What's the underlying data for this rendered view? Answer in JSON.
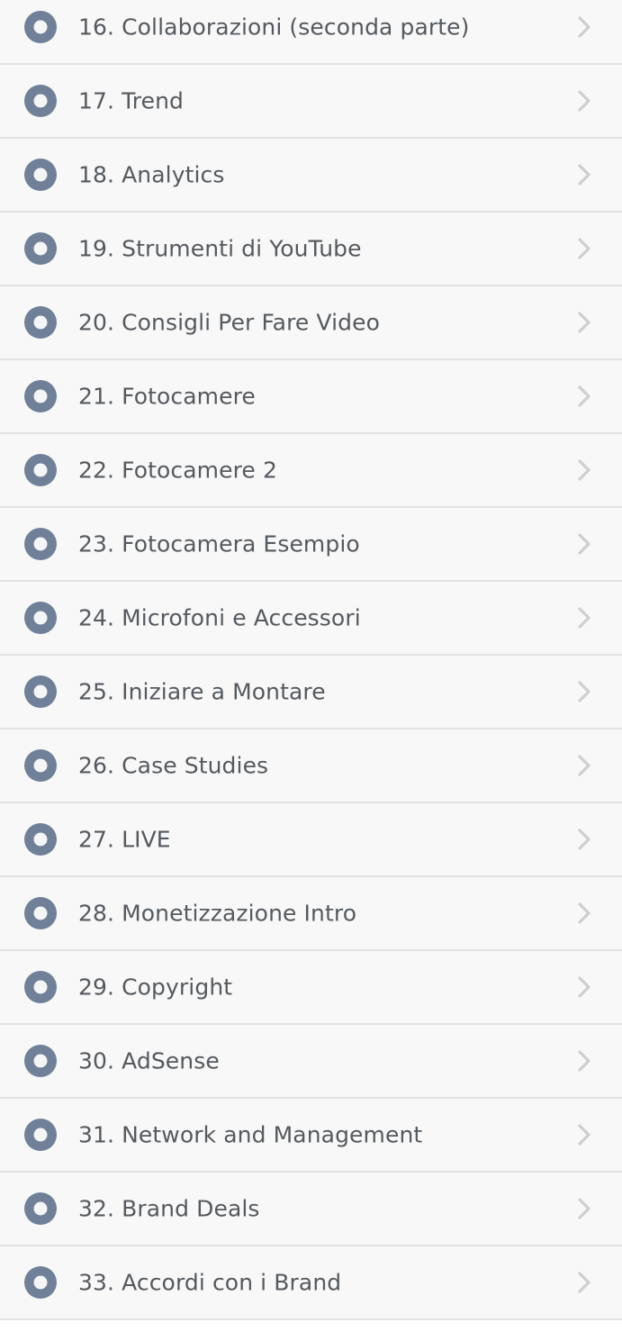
{
  "colors": {
    "row_background": "#f8f8f8",
    "divider": "#e3e3e3",
    "text": "#555a5f",
    "icon_outer": "#6f8098",
    "icon_inner": "#f4f5f7",
    "chevron": "#cfcfcf"
  },
  "lessons": [
    {
      "label": "16. Collaborazioni (seconda parte)",
      "icon": "lesson-status-icon",
      "chevron": "chevron-right-icon"
    },
    {
      "label": "17. Trend",
      "icon": "lesson-status-icon",
      "chevron": "chevron-right-icon"
    },
    {
      "label": "18. Analytics",
      "icon": "lesson-status-icon",
      "chevron": "chevron-right-icon"
    },
    {
      "label": "19. Strumenti di YouTube",
      "icon": "lesson-status-icon",
      "chevron": "chevron-right-icon"
    },
    {
      "label": "20. Consigli Per Fare Video",
      "icon": "lesson-status-icon",
      "chevron": "chevron-right-icon"
    },
    {
      "label": "21. Fotocamere",
      "icon": "lesson-status-icon",
      "chevron": "chevron-right-icon"
    },
    {
      "label": "22. Fotocamere 2",
      "icon": "lesson-status-icon",
      "chevron": "chevron-right-icon"
    },
    {
      "label": "23. Fotocamera Esempio",
      "icon": "lesson-status-icon",
      "chevron": "chevron-right-icon"
    },
    {
      "label": "24. Microfoni e Accessori",
      "icon": "lesson-status-icon",
      "chevron": "chevron-right-icon"
    },
    {
      "label": "25. Iniziare a Montare",
      "icon": "lesson-status-icon",
      "chevron": "chevron-right-icon"
    },
    {
      "label": "26. Case Studies",
      "icon": "lesson-status-icon",
      "chevron": "chevron-right-icon"
    },
    {
      "label": "27. LIVE",
      "icon": "lesson-status-icon",
      "chevron": "chevron-right-icon"
    },
    {
      "label": "28. Monetizzazione Intro",
      "icon": "lesson-status-icon",
      "chevron": "chevron-right-icon"
    },
    {
      "label": "29. Copyright",
      "icon": "lesson-status-icon",
      "chevron": "chevron-right-icon"
    },
    {
      "label": "30. AdSense",
      "icon": "lesson-status-icon",
      "chevron": "chevron-right-icon"
    },
    {
      "label": "31. Network and Management",
      "icon": "lesson-status-icon",
      "chevron": "chevron-right-icon"
    },
    {
      "label": "32. Brand Deals",
      "icon": "lesson-status-icon",
      "chevron": "chevron-right-icon"
    },
    {
      "label": "33. Accordi con i Brand",
      "icon": "lesson-status-icon",
      "chevron": "chevron-right-icon"
    }
  ]
}
